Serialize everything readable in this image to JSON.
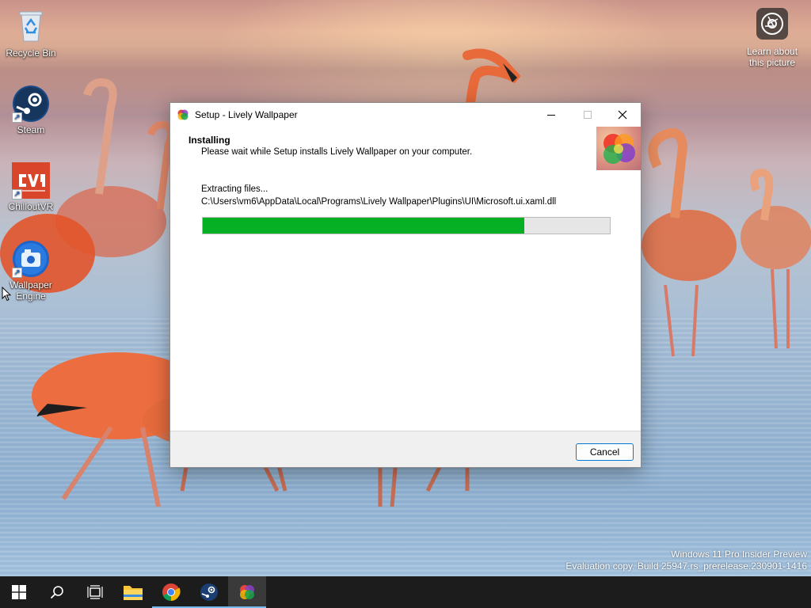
{
  "desktop": {
    "icons": [
      {
        "label": "Recycle Bin",
        "icon": "recycle-bin-icon"
      },
      {
        "label": "Steam",
        "icon": "steam-icon"
      },
      {
        "label": "ChilloutVR",
        "icon": "chilloutvr-icon"
      },
      {
        "label": "Wallpaper Engine",
        "icon": "wallpaper-engine-icon"
      }
    ],
    "learn_picture": {
      "line1": "Learn about",
      "line2": "this picture",
      "icon": "camera-icon"
    },
    "watermark": {
      "line1": "Windows 11 Pro Insider Preview",
      "line2": "Evaluation copy. Build 25947.rs_prerelease.230901-1416"
    }
  },
  "dialog": {
    "title": "Setup - Lively Wallpaper",
    "heading": "Installing",
    "subheading": "Please wait while Setup installs Lively Wallpaper on your computer.",
    "status": "Extracting files...",
    "current_file": "C:\\Users\\vm6\\AppData\\Local\\Programs\\Lively Wallpaper\\Plugins\\UI\\Microsoft.ui.xaml.dll",
    "progress_fraction": 0.79,
    "cancel_label": "Cancel",
    "colors": {
      "progress": "#06b025",
      "button_border": "#0078d7"
    }
  },
  "taskbar": {
    "items": [
      {
        "name": "start",
        "icon": "windows-logo-icon"
      },
      {
        "name": "search",
        "icon": "search-icon"
      },
      {
        "name": "task-view",
        "icon": "task-view-icon"
      },
      {
        "name": "file-explorer",
        "icon": "folder-icon"
      },
      {
        "name": "chrome",
        "icon": "chrome-icon"
      },
      {
        "name": "steam",
        "icon": "steam-icon"
      },
      {
        "name": "lively-wallpaper",
        "icon": "lively-wallpaper-icon"
      }
    ]
  }
}
